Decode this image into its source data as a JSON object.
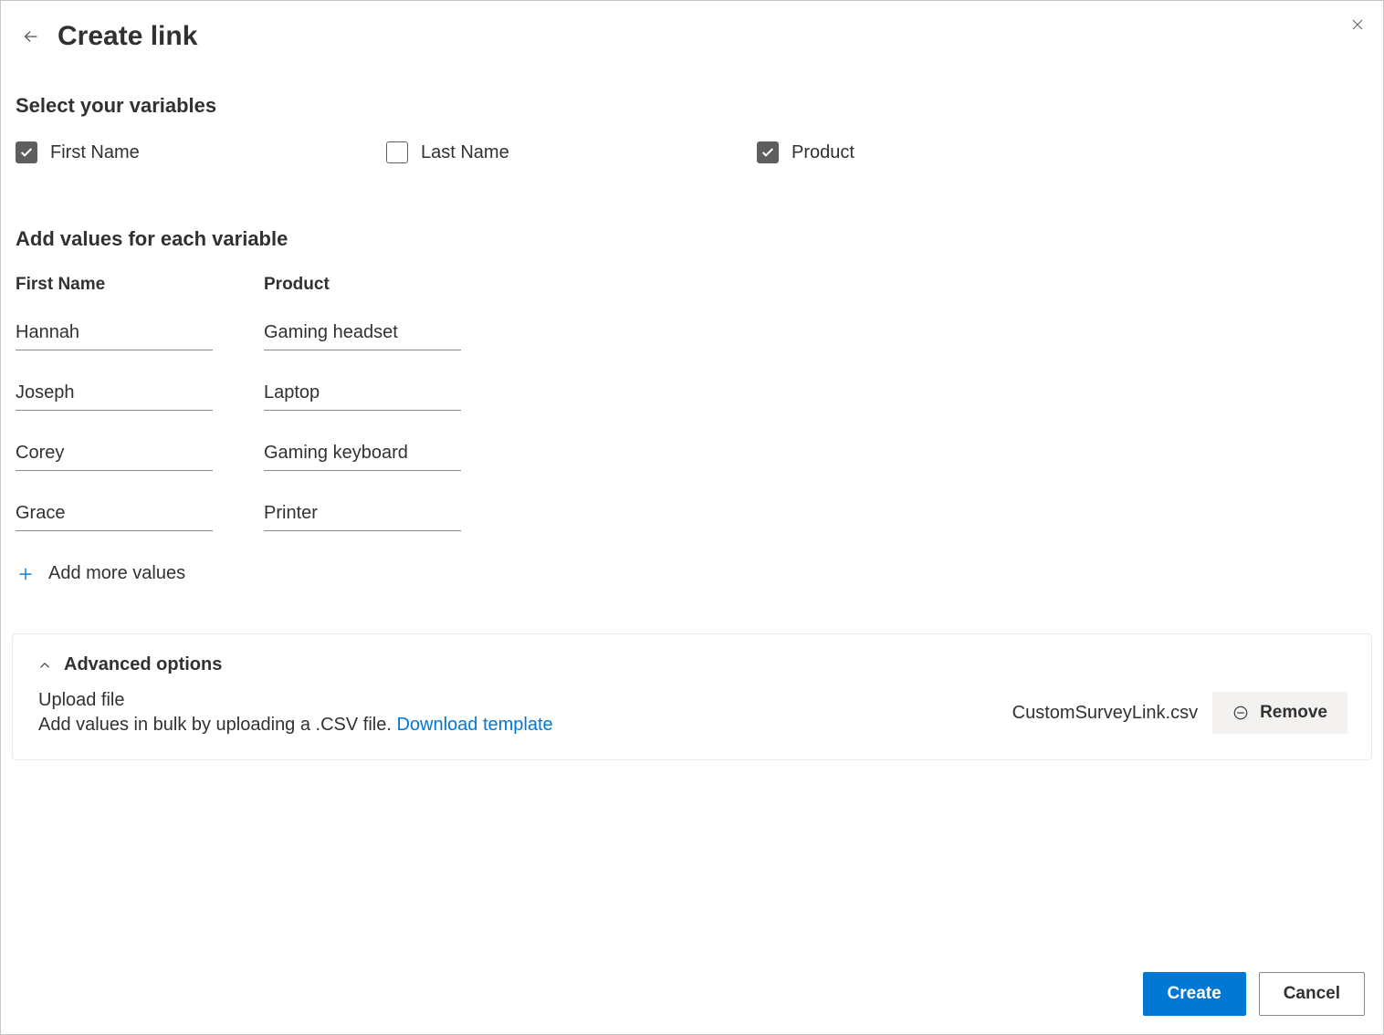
{
  "header": {
    "title": "Create link"
  },
  "variables": {
    "heading": "Select your variables",
    "items": [
      {
        "label": "First Name",
        "checked": true
      },
      {
        "label": "Last Name",
        "checked": false
      },
      {
        "label": "Product",
        "checked": true
      }
    ]
  },
  "values": {
    "heading": "Add values for each variable",
    "columns": [
      "First Name",
      "Product"
    ],
    "rows": [
      {
        "first_name": "Hannah",
        "product": "Gaming headset"
      },
      {
        "first_name": "Joseph",
        "product": "Laptop"
      },
      {
        "first_name": "Corey",
        "product": "Gaming keyboard"
      },
      {
        "first_name": "Grace",
        "product": "Printer"
      }
    ],
    "add_more_label": "Add more values"
  },
  "advanced": {
    "title": "Advanced options",
    "upload_label": "Upload file",
    "upload_desc": "Add values in bulk by uploading a .CSV file. ",
    "download_link": "Download template",
    "file_name": "CustomSurveyLink.csv",
    "remove_label": "Remove"
  },
  "footer": {
    "create_label": "Create",
    "cancel_label": "Cancel"
  }
}
